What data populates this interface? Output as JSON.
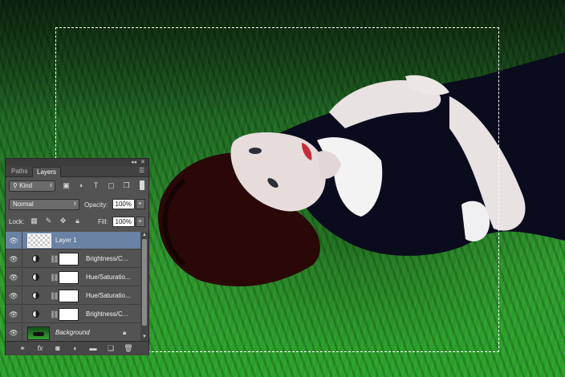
{
  "canvas": {
    "description_colors": {
      "grass": "#2e9a2c",
      "dress": "#0a0a1a",
      "hair": "#2a0a0a",
      "collar": "#f2f2f2",
      "lips": "#c0303a"
    }
  },
  "panel": {
    "tabs": [
      {
        "label": "Paths",
        "active": false
      },
      {
        "label": "Layers",
        "active": true
      }
    ],
    "filter": {
      "kind_label": "Kind"
    },
    "blend_mode": "Normal",
    "opacity_label": "Opacity:",
    "opacity_value": "100%",
    "lock_label": "Lock:",
    "fill_label": "Fill:",
    "fill_value": "100%",
    "layers": [
      {
        "name": "Layer 1",
        "selected": true,
        "visible": true,
        "type": "pixel"
      },
      {
        "name": "Brightness/C...",
        "selected": false,
        "visible": true,
        "type": "adjustment"
      },
      {
        "name": "Hue/Saturatio...",
        "selected": false,
        "visible": true,
        "type": "adjustment"
      },
      {
        "name": "Hue/Saturatio...",
        "selected": false,
        "visible": true,
        "type": "adjustment"
      },
      {
        "name": "Brightness/C...",
        "selected": false,
        "visible": true,
        "type": "adjustment"
      },
      {
        "name": "Background",
        "selected": false,
        "visible": true,
        "type": "background",
        "locked": true
      }
    ],
    "icons": {
      "filter": [
        "image-filter-icon",
        "adjustment-filter-icon",
        "type-filter-icon",
        "shape-filter-icon",
        "smart-object-filter-icon"
      ],
      "lock": [
        "lock-transparent-icon",
        "lock-image-icon",
        "lock-position-icon",
        "lock-all-icon"
      ],
      "bottom": [
        "link-layers-icon",
        "layer-style-icon",
        "add-mask-icon",
        "new-adjustment-icon",
        "new-group-icon",
        "new-layer-icon",
        "delete-layer-icon"
      ]
    },
    "colors": {
      "panel_bg": "#535353",
      "selected_row": "#6a82a3"
    }
  }
}
